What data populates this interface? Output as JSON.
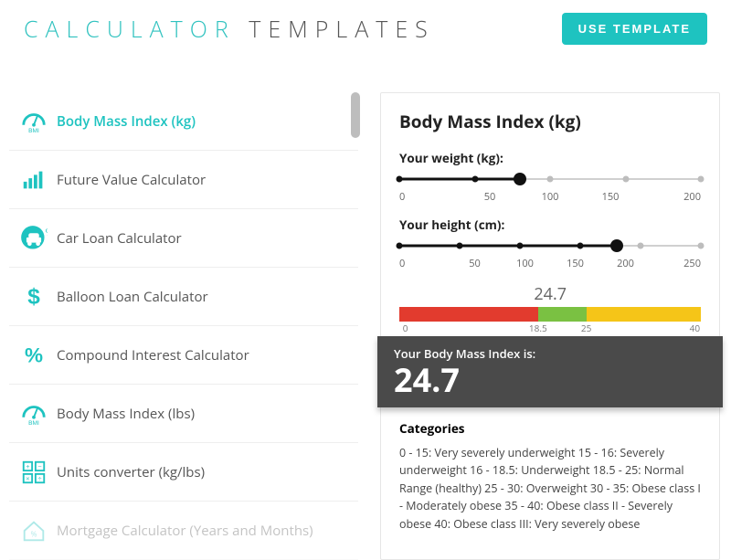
{
  "header": {
    "title_word1": "CALCULATOR",
    "title_word2": "TEMPLATES",
    "use_button": "USE TEMPLATE"
  },
  "sidebar": {
    "items": [
      {
        "label": "Body Mass Index (kg)",
        "icon": "bmi-gauge",
        "active": true
      },
      {
        "label": "Future Value Calculator",
        "icon": "bars"
      },
      {
        "label": "Car Loan Calculator",
        "icon": "car"
      },
      {
        "label": "Balloon Loan Calculator",
        "icon": "dollar"
      },
      {
        "label": "Compound Interest Calculator",
        "icon": "percent"
      },
      {
        "label": "Body Mass Index (lbs)",
        "icon": "bmi-gauge"
      },
      {
        "label": "Units converter (kg/lbs)",
        "icon": "grid"
      },
      {
        "label": "Mortgage Calculator (Years and Months)",
        "icon": "house",
        "faded": true
      }
    ]
  },
  "panel": {
    "title": "Body Mass Index (kg)",
    "weight": {
      "label": "Your weight (kg):",
      "ticks": [
        "0",
        "50",
        "100",
        "150",
        "200"
      ],
      "fill_pct": 40
    },
    "height": {
      "label": "Your height (cm):",
      "ticks": [
        "0",
        "50",
        "100",
        "150",
        "200",
        "250"
      ],
      "fill_pct": 72
    },
    "gauge": {
      "value": "24.7",
      "ticks": {
        "a": "0",
        "b": "18.5",
        "c": "25",
        "d": "40"
      }
    },
    "result": {
      "lead": "Your Body Mass Index is:",
      "value": "24.7"
    },
    "categories": {
      "title": "Categories",
      "text": "0 - 15: Very severely underweight 15 - 16: Severely underweight 16 - 18.5: Underweight 18.5 - 25: Normal Range (healthy) 25 - 30: Overweight 30 - 35: Obese class I - Moderately obese 35 - 40: Obese class II - Severely obese 40: Obese class III: Very severely obese"
    }
  }
}
